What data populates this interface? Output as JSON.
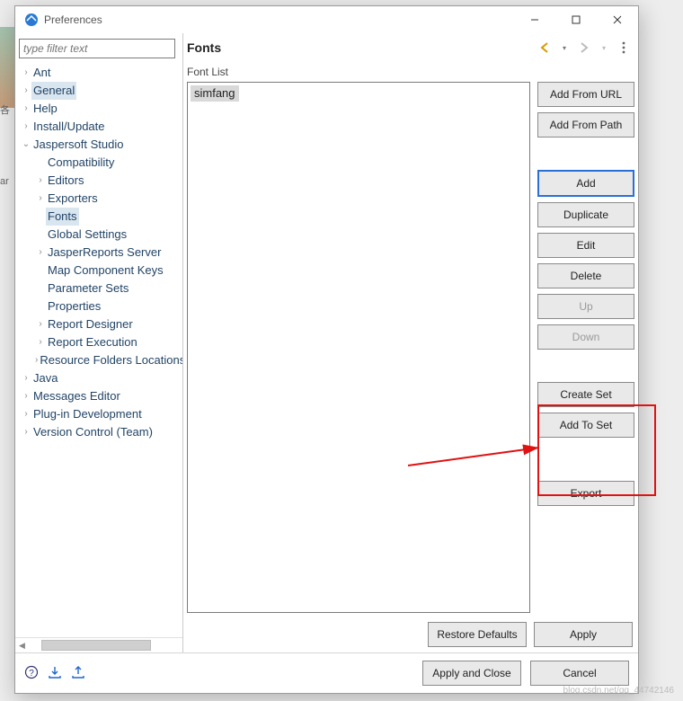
{
  "window": {
    "title": "Preferences",
    "filter_placeholder": "type filter text"
  },
  "tree": {
    "items": [
      {
        "label": "Ant",
        "level": 0,
        "arrow": ">",
        "sel": false
      },
      {
        "label": "General",
        "level": 0,
        "arrow": ">",
        "sel": false,
        "hl": true
      },
      {
        "label": "Help",
        "level": 0,
        "arrow": ">",
        "sel": false
      },
      {
        "label": "Install/Update",
        "level": 0,
        "arrow": ">",
        "sel": false
      },
      {
        "label": "Jaspersoft Studio",
        "level": 0,
        "arrow": "v",
        "sel": false
      },
      {
        "label": "Compatibility",
        "level": 1,
        "arrow": "",
        "sel": false
      },
      {
        "label": "Editors",
        "level": 1,
        "arrow": ">",
        "sel": false
      },
      {
        "label": "Exporters",
        "level": 1,
        "arrow": ">",
        "sel": false
      },
      {
        "label": "Fonts",
        "level": 1,
        "arrow": "",
        "sel": true
      },
      {
        "label": "Global Settings",
        "level": 1,
        "arrow": "",
        "sel": false
      },
      {
        "label": "JasperReports Server",
        "level": 1,
        "arrow": ">",
        "sel": false
      },
      {
        "label": "Map Component Keys",
        "level": 1,
        "arrow": "",
        "sel": false
      },
      {
        "label": "Parameter Sets",
        "level": 1,
        "arrow": "",
        "sel": false
      },
      {
        "label": "Properties",
        "level": 1,
        "arrow": "",
        "sel": false
      },
      {
        "label": "Report Designer",
        "level": 1,
        "arrow": ">",
        "sel": false
      },
      {
        "label": "Report Execution",
        "level": 1,
        "arrow": ">",
        "sel": false
      },
      {
        "label": "Resource Folders Locations",
        "level": 1,
        "arrow": ">",
        "sel": false
      },
      {
        "label": "Java",
        "level": 0,
        "arrow": ">",
        "sel": false
      },
      {
        "label": "Messages Editor",
        "level": 0,
        "arrow": ">",
        "sel": false
      },
      {
        "label": "Plug-in Development",
        "level": 0,
        "arrow": ">",
        "sel": false
      },
      {
        "label": "Version Control (Team)",
        "level": 0,
        "arrow": ">",
        "sel": false
      }
    ]
  },
  "page": {
    "title": "Fonts",
    "section_label": "Font List",
    "font_items": [
      "simfang"
    ]
  },
  "buttons": {
    "add_url": "Add From URL",
    "add_path": "Add From Path",
    "add": "Add",
    "duplicate": "Duplicate",
    "edit": "Edit",
    "delete": "Delete",
    "up": "Up",
    "down": "Down",
    "create_set": "Create Set",
    "add_to_set": "Add To Set",
    "export": "Export",
    "restore": "Restore Defaults",
    "apply": "Apply",
    "apply_close": "Apply and Close",
    "cancel": "Cancel"
  },
  "watermark": "blog.csdn.net/qq_44742146"
}
